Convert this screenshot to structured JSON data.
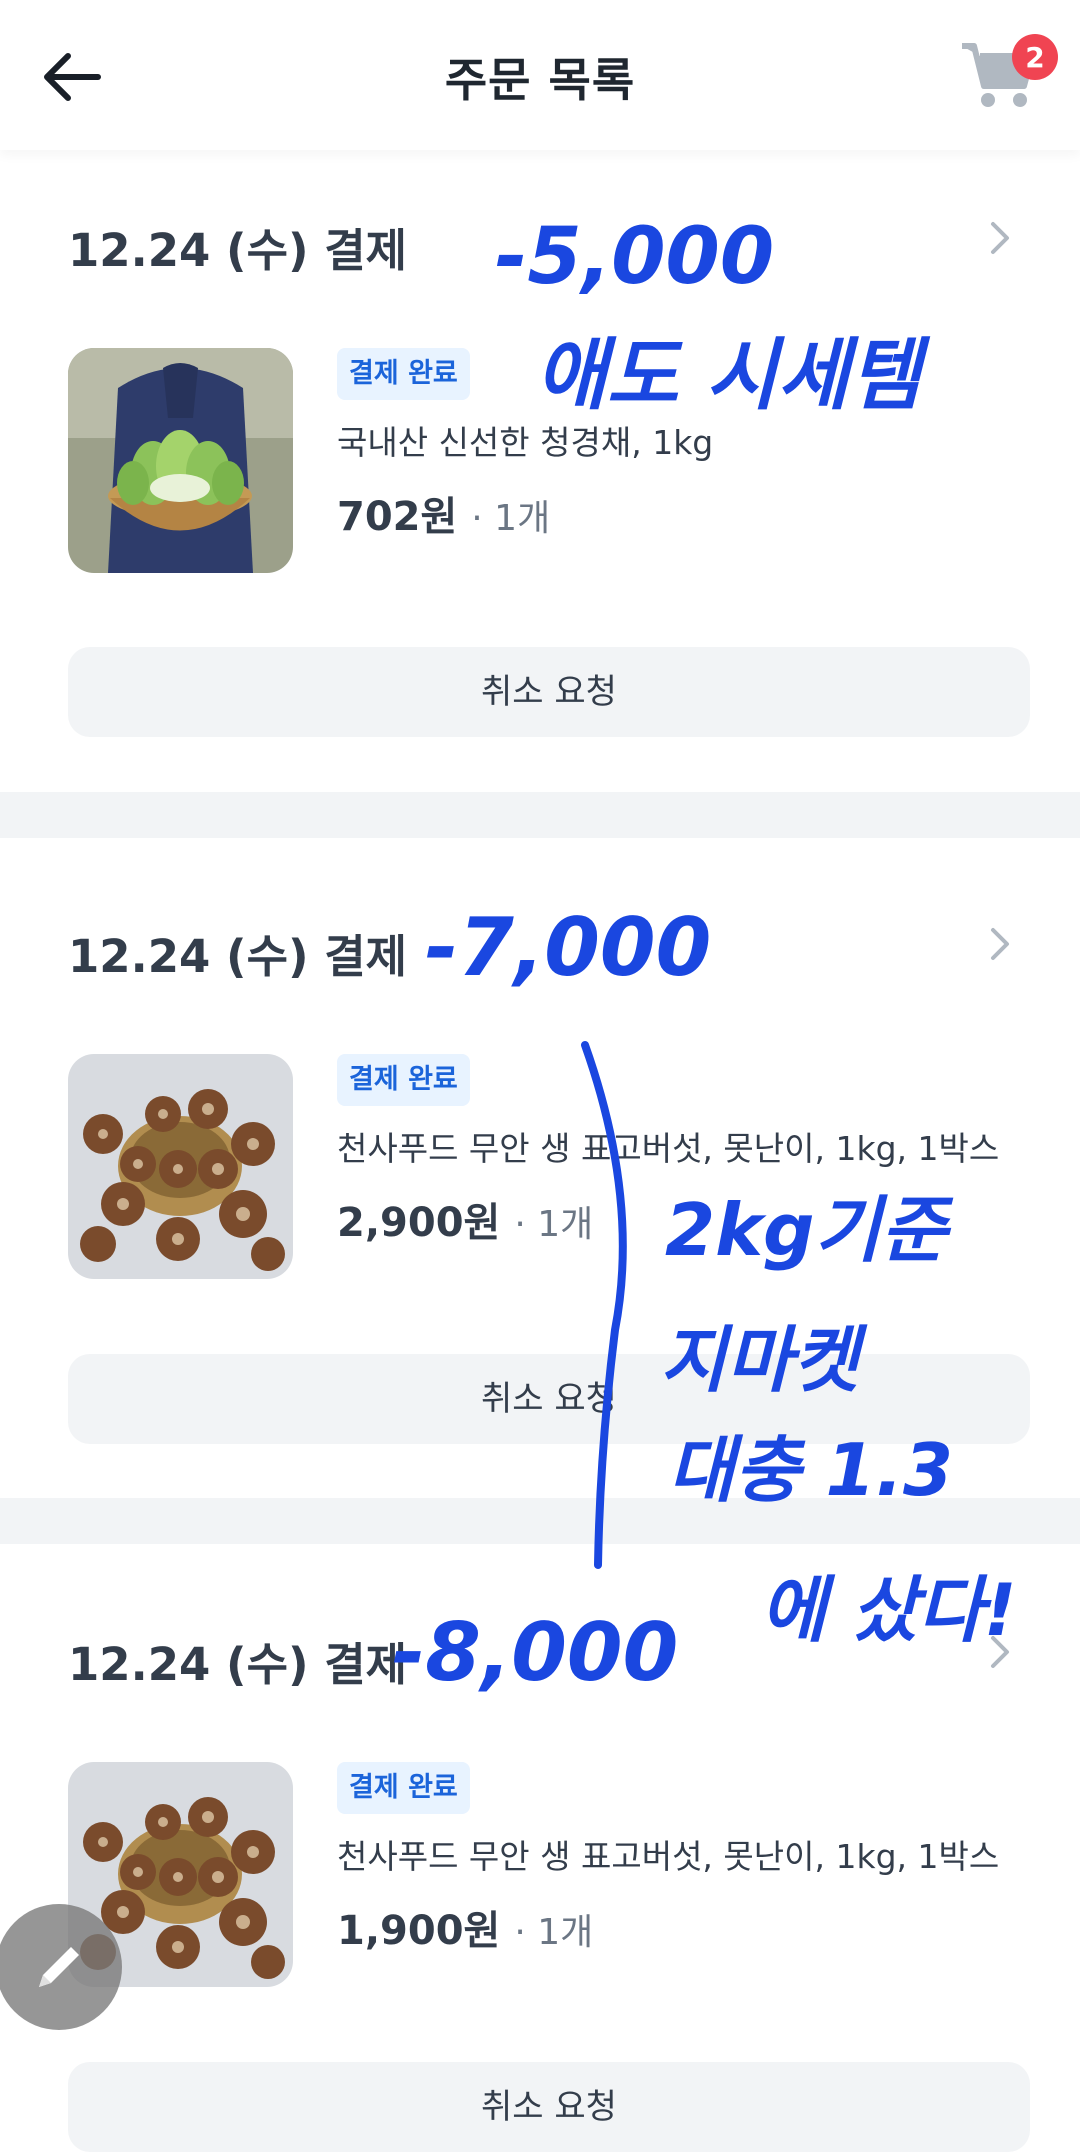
{
  "header": {
    "title": "주문 목록",
    "cart_count": "2"
  },
  "orders": [
    {
      "date": "12.24 (수) 결제",
      "status": "결제 완료",
      "product": "국내산 신선한 청경채, 1kg",
      "price": "702원",
      "qty": "· 1개",
      "cancel_label": "취소 요청",
      "image": "bok-choy-basket-photo"
    },
    {
      "date": "12.24 (수) 결제",
      "status": "결제 완료",
      "product": "천사푸드 무안 생 표고버섯, 못난이, 1kg, 1박스",
      "price": "2,900원",
      "qty": "· 1개",
      "cancel_label": "취소 요청",
      "image": "shiitake-mushroom-basket-photo"
    },
    {
      "date": "12.24 (수) 결제",
      "status": "결제 완료",
      "product": "천사푸드 무안 생 표고버섯, 못난이, 1kg, 1박스",
      "price": "1,900원",
      "qty": "· 1개",
      "cancel_label": "취소 요청",
      "image": "shiitake-mushroom-basket-photo"
    }
  ],
  "handwritten_notes": {
    "note1_amount": "-5,000",
    "note1_text": "애도 시세템",
    "note2_amount": "-7,000",
    "note3_amount": "-8,000",
    "side_note_line1": "2kg기준",
    "side_note_line2": "지마켓",
    "side_note_line3": "대충 1.3",
    "side_note_line4": "에 샀다!"
  },
  "colors": {
    "accent_blue": "#1b64da",
    "badge_bg": "#e8f3ff",
    "cart_badge": "#f04452",
    "handwriting_ink": "#1a47e0",
    "divider": "#f2f4f6"
  },
  "icons": {
    "back": "arrow-left-icon",
    "cart": "cart-icon",
    "chevron": "chevron-right-icon",
    "edit_fab": "pencil-icon"
  }
}
